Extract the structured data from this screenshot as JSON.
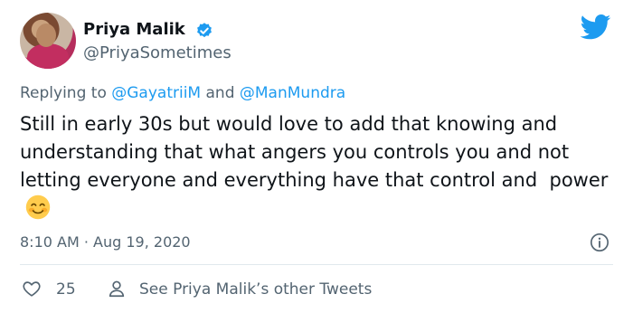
{
  "author": {
    "display_name": "Priya Malik",
    "handle": "@PriyaSometimes",
    "avatar_icon": "avatar",
    "verified_icon": "verified-badge-icon"
  },
  "reply": {
    "prefix": "Replying to",
    "mention_1": "@GayatriiM",
    "joiner": "and",
    "mention_2": "@ManMundra"
  },
  "tweet": {
    "text": "Still in early 30s but would love to add that knowing and understanding that what angers you controls you and not letting everyone and everything have that control and  power",
    "emoji_icon": "smiling-face-icon"
  },
  "meta": {
    "timestamp": "8:10 AM · Aug 19, 2020"
  },
  "actions": {
    "like_count": "25",
    "other_tweets_label": "See Priya Malik’s other Tweets"
  },
  "colors": {
    "accent": "#1d9bf0",
    "secondary_text": "#536471",
    "primary_text": "#0f1419"
  }
}
